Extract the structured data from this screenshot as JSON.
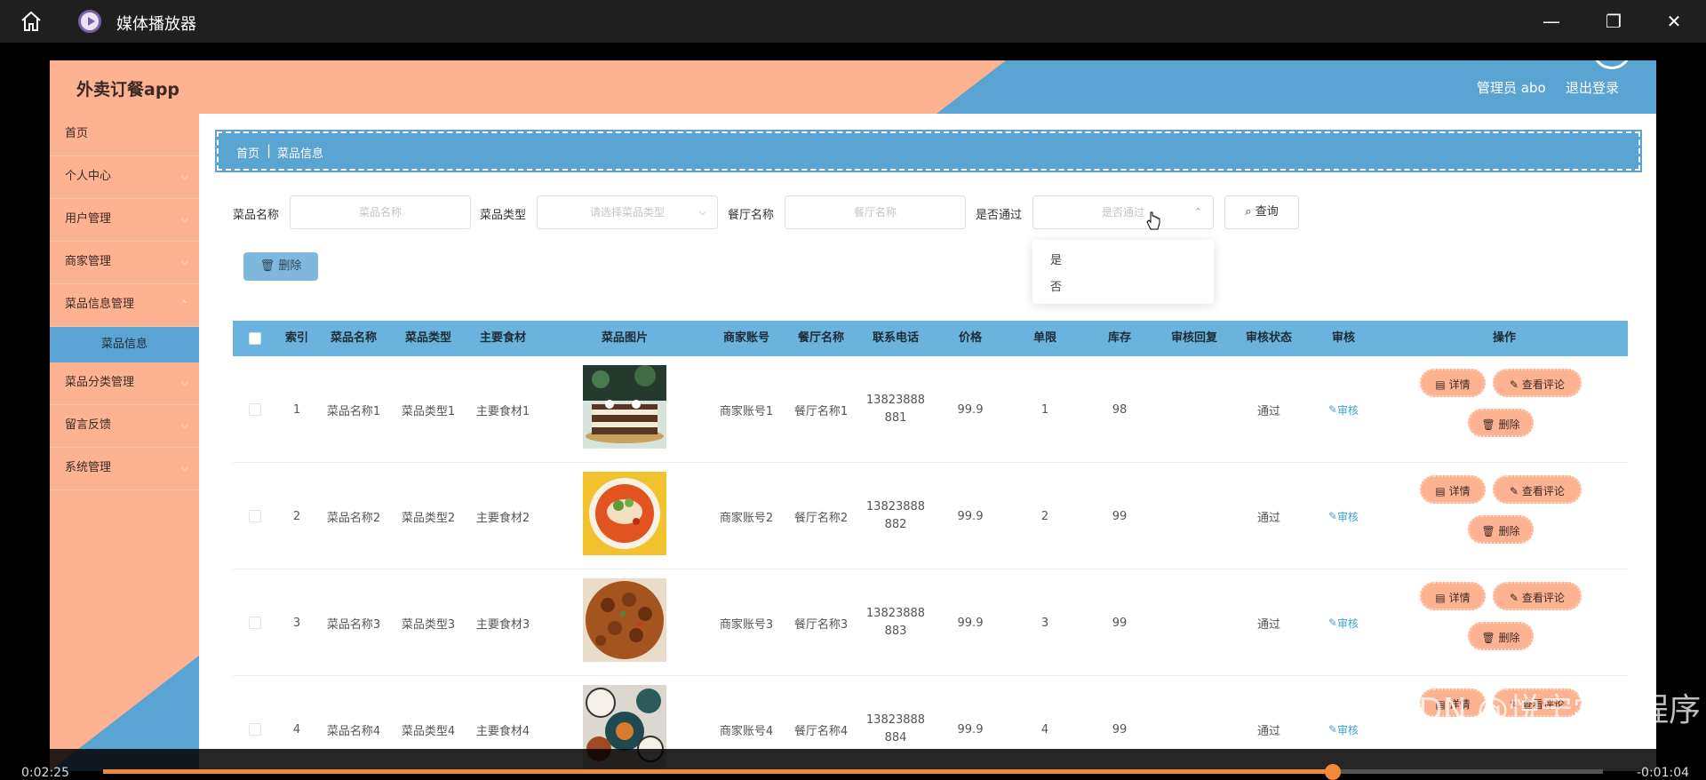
{
  "window": {
    "title": "媒体播放器"
  },
  "app": {
    "title": "外卖订餐app",
    "admin": "管理员 abo",
    "logout": "退出登录"
  },
  "sidebar": {
    "items": [
      {
        "label": "首页"
      },
      {
        "label": "个人中心"
      },
      {
        "label": "用户管理"
      },
      {
        "label": "商家管理"
      },
      {
        "label": "菜品信息管理"
      },
      {
        "label": "菜品分类管理"
      },
      {
        "label": "留言反馈"
      },
      {
        "label": "系统管理"
      }
    ],
    "sub_active": "菜品信息"
  },
  "breadcrumb": {
    "home": "首页",
    "separator": "|",
    "current": "菜品信息"
  },
  "filters": {
    "name_label": "菜品名称",
    "name_placeholder": "菜品名称",
    "type_label": "菜品类型",
    "type_placeholder": "请选择菜品类型",
    "shop_label": "餐厅名称",
    "shop_placeholder": "餐厅名称",
    "pass_label": "是否通过",
    "pass_placeholder": "是否通过",
    "search_label": "查询",
    "pass_options": [
      "是",
      "否"
    ]
  },
  "toolbar": {
    "delete_label": "删除"
  },
  "table": {
    "headers": [
      "索引",
      "菜品名称",
      "菜品类型",
      "主要食材",
      "菜品图片",
      "商家账号",
      "餐厅名称",
      "联系电话",
      "价格",
      "单限",
      "库存",
      "审核回复",
      "审核状态",
      "审核",
      "操作"
    ],
    "rows": [
      {
        "index": "1",
        "name": "菜品名称1",
        "type": "菜品类型1",
        "ingredient": "主要食材1",
        "account": "商家账号1",
        "shop": "餐厅名称1",
        "phone1": "13823888",
        "phone2": "881",
        "price": "99.9",
        "limit": "1",
        "stock": "98",
        "reply": "",
        "status": "通过",
        "audit": "审核"
      },
      {
        "index": "2",
        "name": "菜品名称2",
        "type": "菜品类型2",
        "ingredient": "主要食材2",
        "account": "商家账号2",
        "shop": "餐厅名称2",
        "phone1": "13823888",
        "phone2": "882",
        "price": "99.9",
        "limit": "2",
        "stock": "99",
        "reply": "",
        "status": "通过",
        "audit": "审核"
      },
      {
        "index": "3",
        "name": "菜品名称3",
        "type": "菜品类型3",
        "ingredient": "主要食材3",
        "account": "商家账号3",
        "shop": "餐厅名称3",
        "phone1": "13823888",
        "phone2": "883",
        "price": "99.9",
        "limit": "3",
        "stock": "99",
        "reply": "",
        "status": "通过",
        "audit": "审核"
      },
      {
        "index": "4",
        "name": "菜品名称4",
        "type": "菜品类型4",
        "ingredient": "主要食材4",
        "account": "商家账号4",
        "shop": "餐厅名称4",
        "phone1": "13823888",
        "phone2": "884",
        "price": "99.9",
        "limit": "4",
        "stock": "99",
        "reply": "",
        "status": "通过",
        "audit": "审核"
      }
    ],
    "op_detail": "详情",
    "op_comments": "查看评论",
    "op_delete": "删除"
  },
  "player": {
    "elapsed": "0:02:25",
    "remaining": "-0:01:04",
    "progress": 0.82
  },
  "watermark": "CSDN @悦宁学姐程序",
  "colors": {
    "peach": "#fdb391",
    "blue": "#5aa4d3",
    "accent": "#f08a3a"
  }
}
